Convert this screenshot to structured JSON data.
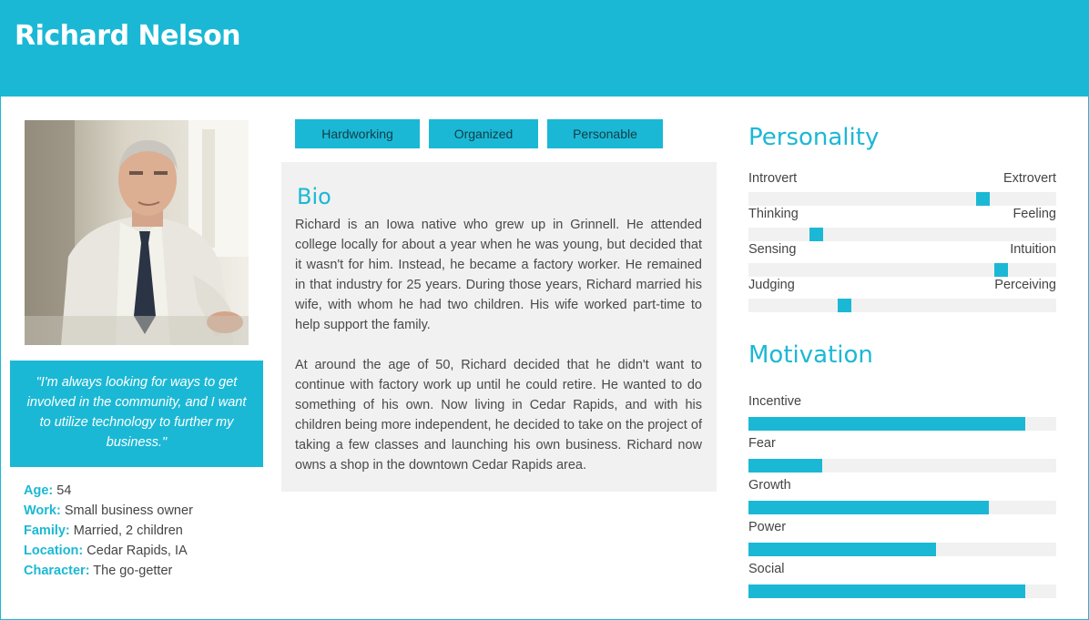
{
  "persona": {
    "name": "Richard Nelson"
  },
  "quote": "\"I'm always looking for ways to get involved in the community, and I want to utilize technology to further my business.\"",
  "facts": [
    {
      "key": "Age:",
      "value": " 54"
    },
    {
      "key": "Work:",
      "value": " Small business owner"
    },
    {
      "key": "Family:",
      "value": " Married, 2 children"
    },
    {
      "key": "Location:",
      "value": " Cedar Rapids, IA"
    },
    {
      "key": "Character:",
      "value": " The go-getter"
    }
  ],
  "tags": [
    "Hardworking",
    "Organized",
    "Personable"
  ],
  "bio": {
    "title": "Bio",
    "paragraphs": [
      "Richard is an Iowa native who grew up in Grinnell. He attended college locally for about a year when he was young, but decided that it wasn't for him. Instead, he became a factory worker. He remained in that industry for 25 years. During those years, Richard married his wife, with whom he had two children. His wife worked part-time to help support the family.",
      "At around the age of 50, Richard decided that he didn't want to continue with factory work up until he could retire. He wanted to do something of his own. Now living in Cedar Rapids, and with his children being more independent, he decided to take on the project of taking a few classes and launching his own business. Richard now owns a shop in the downtown Cedar Rapids area."
    ]
  },
  "personality": {
    "title": "Personality",
    "traits": [
      {
        "left": "Introvert",
        "right": "Extrovert",
        "level": 0.76
      },
      {
        "left": "Thinking",
        "right": "Feeling",
        "level": 0.22
      },
      {
        "left": "Sensing",
        "right": "Intuition",
        "level": 0.82
      },
      {
        "left": "Judging",
        "right": "Perceiving",
        "level": 0.31
      }
    ]
  },
  "motivation": {
    "title": "Motivation",
    "items": [
      {
        "label": "Incentive",
        "level": 0.9
      },
      {
        "label": "Fear",
        "level": 0.24
      },
      {
        "label": "Growth",
        "level": 0.78
      },
      {
        "label": "Power",
        "level": 0.61
      },
      {
        "label": "Social",
        "level": 0.9
      }
    ]
  },
  "colors": {
    "accent": "#1bb8d5",
    "panel": "#f1f1f1",
    "track": "#f1f1f1"
  }
}
